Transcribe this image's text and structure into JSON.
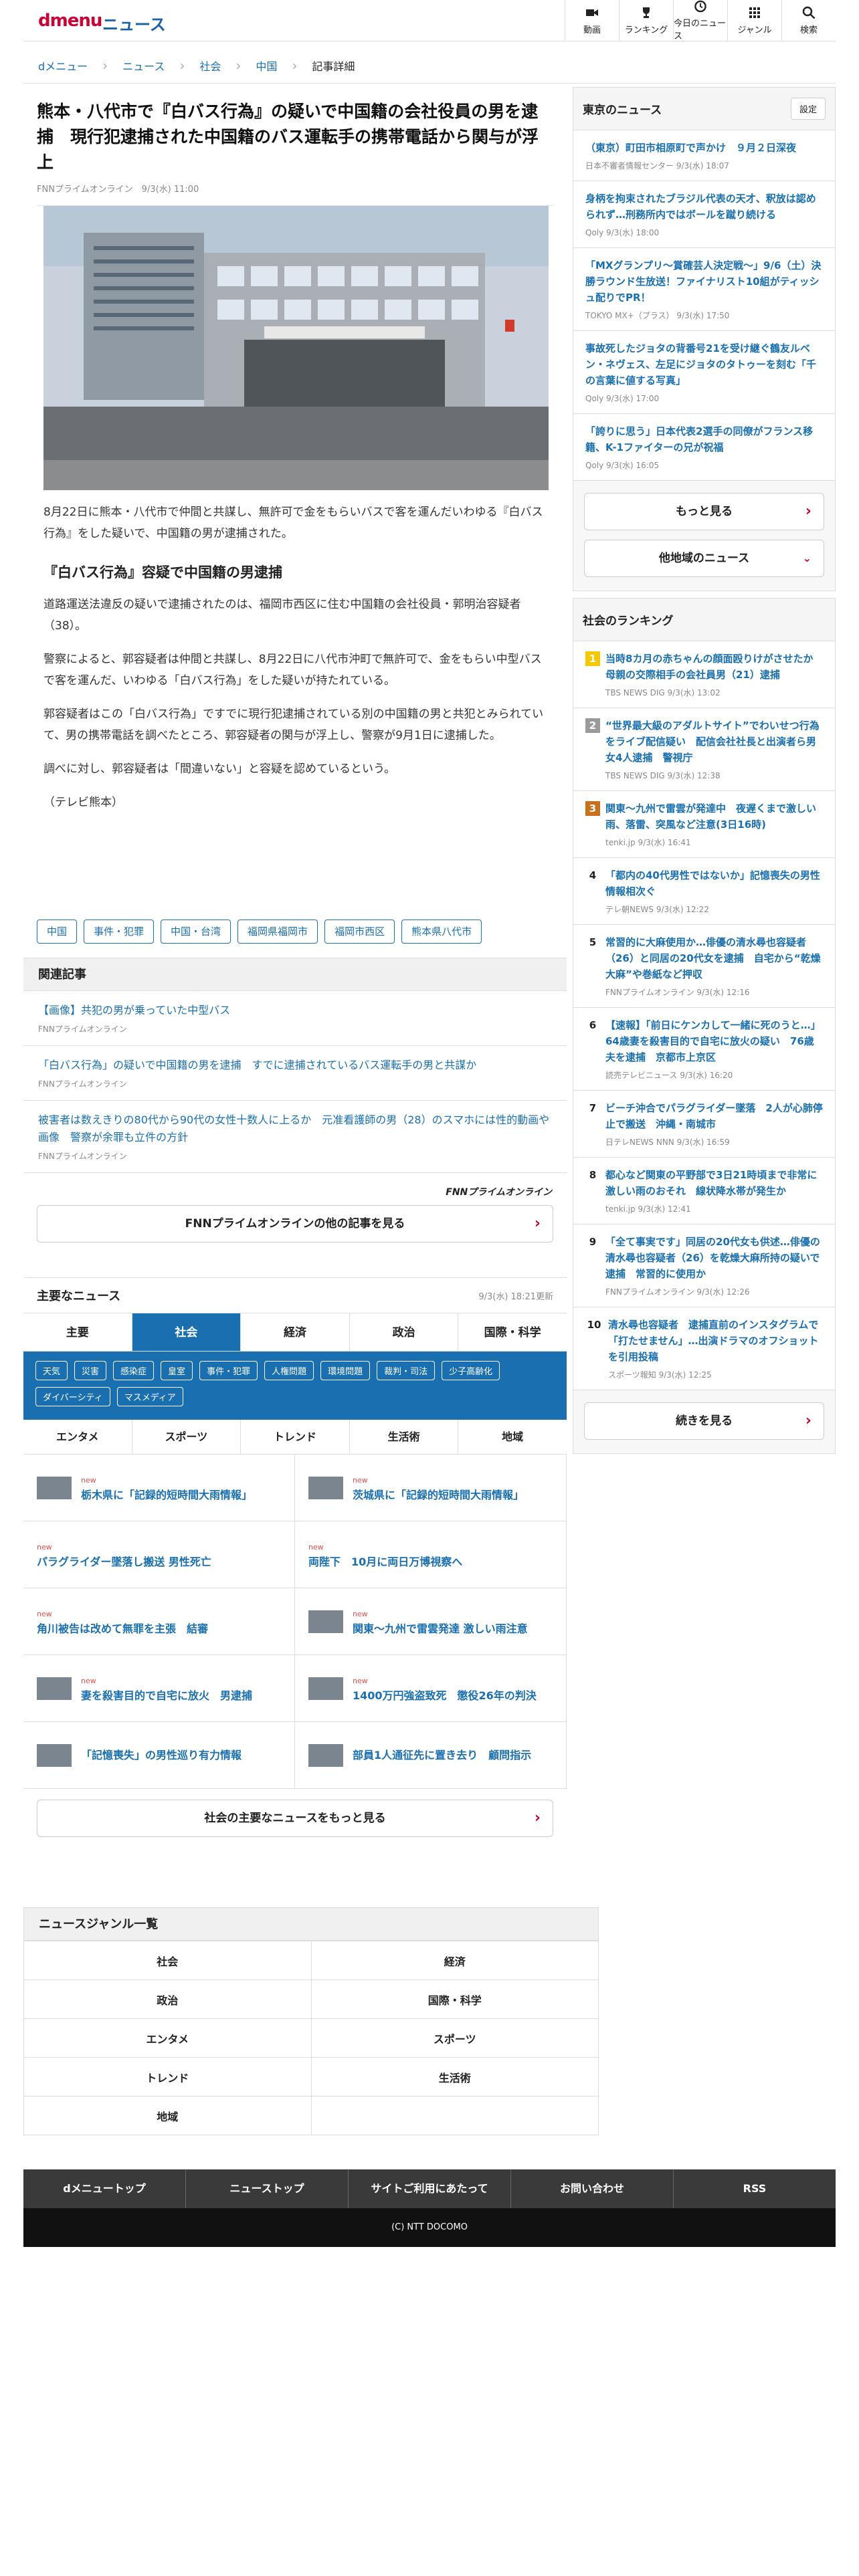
{
  "header": {
    "logo": "dmenu",
    "service": "ニュース",
    "nav": [
      {
        "icon": "video-icon",
        "label": "動画"
      },
      {
        "icon": "trophy-icon",
        "label": "ランキング"
      },
      {
        "icon": "clock-icon",
        "label": "今日のニュース"
      },
      {
        "icon": "grid-icon",
        "label": "ジャンル"
      },
      {
        "icon": "search-icon",
        "label": "検索"
      }
    ]
  },
  "breadcrumb": [
    "dメニュー",
    "ニュース",
    "社会",
    "中国",
    "記事詳細"
  ],
  "article": {
    "title": "熊本・八代市で『白バス行為』の疑いで中国籍の会社役員の男を逮捕　現行犯逮捕された中国籍のバス運転手の携帯電話から関与が浮上",
    "meta": "FNNプライムオンライン　9/3(水) 11:00",
    "lead": "8月22日に熊本・八代市で仲間と共謀し、無許可で金をもらいバスで客を運んだいわゆる『白バス行為』をした疑いで、中国籍の男が逮捕された。",
    "subhead": "『白バス行為』容疑で中国籍の男逮捕",
    "p1": "道路運送法違反の疑いで逮捕されたのは、福岡市西区に住む中国籍の会社役員・郭明治容疑者（38）。",
    "p2": "警察によると、郭容疑者は仲間と共謀し、8月22日に八代市沖町で無許可で、金をもらい中型バスで客を運んだ、いわゆる「白バス行為」をした疑いが持たれている。",
    "p3": "郭容疑者はこの「白バス行為」ですでに現行犯逮捕されている別の中国籍の男と共犯とみられていて、男の携帯電話を調べたところ、郭容疑者の関与が浮上し、警察が9月1日に逮捕した。",
    "p4": "調べに対し、郭容疑者は「間違いない」と容疑を認めているという。",
    "p5": "（テレビ熊本）",
    "tags": [
      "中国",
      "事件・犯罪",
      "中国・台湾",
      "福岡県福岡市",
      "福岡市西区",
      "熊本県八代市"
    ]
  },
  "related": {
    "heading": "関連記事",
    "items": [
      {
        "title": "【画像】共犯の男が乗っていた中型バス",
        "source": "FNNプライムオンライン"
      },
      {
        "title": "「白バス行為」の疑いで中国籍の男を逮捕　すでに逮捕されているバス運転手の男と共謀か",
        "source": "FNNプライムオンライン"
      },
      {
        "title": "被害者は数えきりの80代から90代の女性十数人に上るか　元准看護師の男（28）のスマホには性的動画や画像　警察が余罪も立件の方針",
        "source": "FNNプライムオンライン"
      }
    ],
    "brand": "FNNプライムオンライン",
    "more": "FNNプライムオンラインの他の記事を見る"
  },
  "major": {
    "heading": "主要なニュース",
    "updated": "9/3(水) 18:21更新",
    "tabs": [
      "主要",
      "社会",
      "経済",
      "政治",
      "国際・科学"
    ],
    "subtags": [
      "天気",
      "災害",
      "感染症",
      "皇室",
      "事件・犯罪",
      "人権問題",
      "環境問題",
      "裁判・司法",
      "少子高齢化",
      "ダイバーシティ",
      "マスメディア"
    ],
    "tabs2": [
      "エンタメ",
      "スポーツ",
      "トレンド",
      "生活術",
      "地域"
    ],
    "new_label": "new",
    "items": [
      {
        "title": "栃木県に「記録的短時間大雨情報」",
        "new": true,
        "thumb": true
      },
      {
        "title": "茨城県に「記録的短時間大雨情報」",
        "new": true,
        "thumb": true
      },
      {
        "title": "パラグライダー墜落し搬送 男性死亡",
        "new": true,
        "thumb": false
      },
      {
        "title": "両陛下　10月に両日万博視察へ",
        "new": true,
        "thumb": false
      },
      {
        "title": "角川被告は改めて無罪を主張　結審",
        "new": true,
        "thumb": false
      },
      {
        "title": "関東〜九州で雷雲発達 激しい雨注意",
        "new": true,
        "thumb": true
      },
      {
        "title": "妻を殺害目的で自宅に放火　男逮捕",
        "new": true,
        "thumb": true
      },
      {
        "title": "1400万円強盗致死　懲役26年の判決",
        "new": true,
        "thumb": true
      },
      {
        "title": "「記憶喪失」の男性巡り有力情報",
        "new": false,
        "thumb": true
      },
      {
        "title": "部員1人通征先に置き去り　顧問指示",
        "new": false,
        "thumb": true
      }
    ],
    "more": "社会の主要なニュースをもっと見る"
  },
  "local": {
    "heading": "東京のニュース",
    "settings": "設定",
    "items": [
      {
        "title": "（東京）町田市相原町で声かけ　９月２日深夜",
        "source": "日本不審者情報センター 9/3(水) 18:07"
      },
      {
        "title": "身柄を拘束されたブラジル代表の天才、釈放は認められず…刑務所内ではボールを蹴り続ける",
        "source": "Qoly 9/3(水) 18:00"
      },
      {
        "title": "「MXグランプリ〜賞確芸人決定戦〜」9/6（土）決勝ラウンド生放送！ファイナリスト10組がティッシュ配りでPR！",
        "source": "TOKYO MX+（プラス） 9/3(水) 17:50"
      },
      {
        "title": "事故死したジョタの背番号21を受け継ぐ鶴友ルベン・ネヴェス、左足にジョタのタトゥーを刻む「千の言葉に値する写真」",
        "source": "Qoly 9/3(水) 17:00"
      },
      {
        "title": "「誇りに思う」日本代表2選手の同僚がフランス移籍、K-1ファイターの兄が祝福",
        "source": "Qoly 9/3(水) 16:05"
      }
    ],
    "more": "もっと見る",
    "other": "他地域のニュース"
  },
  "ranking": {
    "heading": "社会のランキング",
    "items": [
      {
        "rank": "1",
        "title": "当時8カ月の赤ちゃんの顔面殴りけがさせたか　母親の交際相手の会社員男（21）逮捕",
        "source": "TBS NEWS DIG 9/3(水) 13:02"
      },
      {
        "rank": "2",
        "title": "“世界最大級のアダルトサイト”でわいせつ行為をライブ配信疑い　配信会社社長と出演者ら男女4人逮捕　警視庁",
        "source": "TBS NEWS DIG 9/3(水) 12:38"
      },
      {
        "rank": "3",
        "title": "関東〜九州で雷雲が発達中　夜遅くまで激しい雨、落雷、突風など注意(3日16時)",
        "source": "tenki.jp 9/3(水) 16:41"
      },
      {
        "rank": "4",
        "title": "「都内の40代男性ではないか」記憶喪失の男性　情報相次ぐ",
        "source": "テレ朝NEWS 9/3(水) 12:22"
      },
      {
        "rank": "5",
        "title": "常習的に大麻使用か…俳優の清水尋也容疑者（26）と同居の20代女を逮捕　自宅から“乾燥大麻”や巻紙など押収",
        "source": "FNNプライムオンライン 9/3(水) 12:16"
      },
      {
        "rank": "6",
        "title": "【速報】「前日にケンカして一緒に死のうと…」64歳妻を殺害目的で自宅に放火の疑い　76歳夫を逮捕　京都市上京区",
        "source": "読売テレビニュース 9/3(水) 16:20"
      },
      {
        "rank": "7",
        "title": "ビーチ沖合でパラグライダー墜落　2人が心肺停止で搬送　沖縄・南城市",
        "source": "日テレNEWS NNN 9/3(水) 16:59"
      },
      {
        "rank": "8",
        "title": "都心など関東の平野部で3日21時頃まで非常に激しい雨のおそれ　線状降水帯が発生か",
        "source": "tenki.jp 9/3(水) 12:41"
      },
      {
        "rank": "9",
        "title": "「全て事実です」同居の20代女も供述…俳優の清水尋也容疑者（26）を乾燥大麻所持の疑いで逮捕　常習的に使用か",
        "source": "FNNプライムオンライン 9/3(水) 12:26"
      },
      {
        "rank": "10",
        "title": "清水尋也容疑者　逮捕直前のインスタグラムで「打たせません」…出演ドラマのオフショットを引用投稿",
        "source": "スポーツ報知 9/3(水) 12:25"
      }
    ],
    "more": "続きを見る"
  },
  "genres": {
    "heading": "ニュースジャンル一覧",
    "items": [
      "社会",
      "経済",
      "政治",
      "国際・科学",
      "エンタメ",
      "スポーツ",
      "トレンド",
      "生活術",
      "地域"
    ]
  },
  "footer": {
    "links": [
      "dメニュートップ",
      "ニューストップ",
      "サイトご利用にあたって",
      "お問い合わせ",
      "RSS"
    ],
    "copyright": "(C) NTT DOCOMO"
  },
  "colors": {
    "brand": "#cc0033",
    "link": "#1a6fb0",
    "rank1": "#f5c800",
    "rank2": "#9a9a9a",
    "rank3": "#c8701e"
  }
}
